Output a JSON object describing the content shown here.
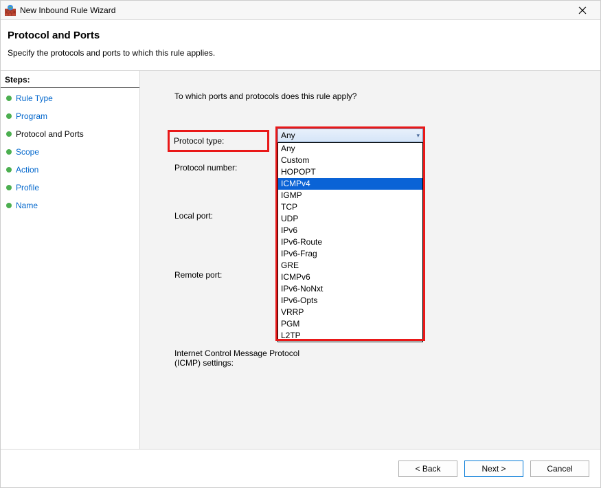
{
  "window": {
    "title": "New Inbound Rule Wizard"
  },
  "header": {
    "title": "Protocol and Ports",
    "subtitle": "Specify the protocols and ports to which this rule applies."
  },
  "steps": {
    "header": "Steps:",
    "items": [
      {
        "label": "Rule Type",
        "current": false
      },
      {
        "label": "Program",
        "current": false
      },
      {
        "label": "Protocol and Ports",
        "current": true
      },
      {
        "label": "Scope",
        "current": false
      },
      {
        "label": "Action",
        "current": false
      },
      {
        "label": "Profile",
        "current": false
      },
      {
        "label": "Name",
        "current": false
      }
    ]
  },
  "main": {
    "question": "To which ports and protocols does this rule apply?",
    "labels": {
      "protocol_type": "Protocol type:",
      "protocol_number": "Protocol number:",
      "local_port": "Local port:",
      "remote_port": "Remote port:",
      "icmp_line1": "Internet Control Message Protocol",
      "icmp_line2": "(ICMP) settings:"
    },
    "protocol_type_value": "Any",
    "protocol_options": [
      "Any",
      "Custom",
      "HOPOPT",
      "ICMPv4",
      "IGMP",
      "TCP",
      "UDP",
      "IPv6",
      "IPv6-Route",
      "IPv6-Frag",
      "GRE",
      "ICMPv6",
      "IPv6-NoNxt",
      "IPv6-Opts",
      "VRRP",
      "PGM",
      "L2TP"
    ],
    "selected_option": "ICMPv4"
  },
  "footer": {
    "back": "< Back",
    "next": "Next >",
    "cancel": "Cancel"
  }
}
